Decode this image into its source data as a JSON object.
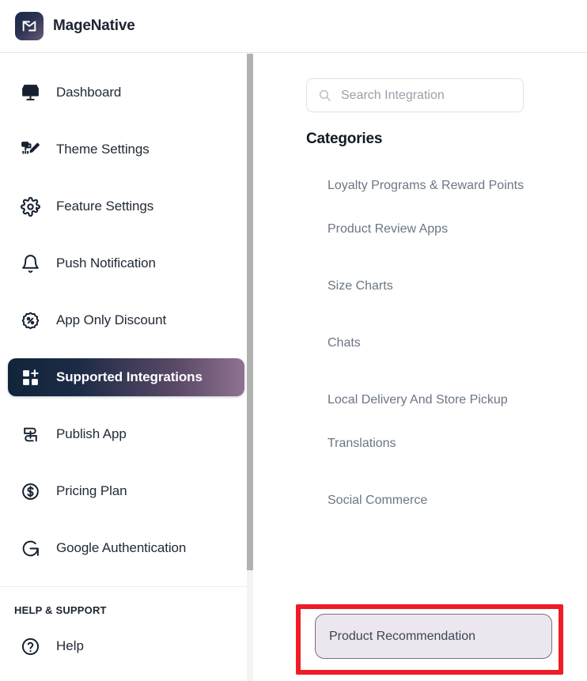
{
  "header": {
    "brand_name": "MageNative",
    "logo_icon": "magenative-monogram-icon"
  },
  "sidebar": {
    "items": [
      {
        "label": "Dashboard",
        "icon": "storefront-icon",
        "active": false
      },
      {
        "label": "Theme Settings",
        "icon": "paint-roller-pencil-icon",
        "active": false
      },
      {
        "label": "Feature Settings",
        "icon": "gear-icon",
        "active": false
      },
      {
        "label": "Push Notification",
        "icon": "bell-icon",
        "active": false
      },
      {
        "label": "App Only Discount",
        "icon": "discount-badge-icon",
        "active": false
      },
      {
        "label": "Supported Integrations",
        "icon": "grid-plus-icon",
        "active": true
      },
      {
        "label": "Publish App",
        "icon": "publish-app-icon",
        "active": false
      },
      {
        "label": "Pricing Plan",
        "icon": "dollar-circle-icon",
        "active": false
      },
      {
        "label": "Google Authentication",
        "icon": "google-g-icon",
        "active": false
      }
    ],
    "help_section": {
      "title": "HELP & SUPPORT",
      "items": [
        {
          "label": "Help",
          "icon": "question-circle-icon"
        }
      ]
    },
    "active_gradient_from": "#10253a",
    "active_gradient_to": "#8f7291"
  },
  "main": {
    "search": {
      "placeholder": "Search Integration",
      "value": "",
      "icon": "search-icon"
    },
    "categories_heading": "Categories",
    "categories": [
      {
        "label": "Loyalty Programs & Reward Points",
        "selected": false
      },
      {
        "label": "Product Review Apps",
        "selected": false
      },
      {
        "label": "Size Charts",
        "selected": false
      },
      {
        "label": "Chats",
        "selected": false
      },
      {
        "label": "Local Delivery And Store Pickup",
        "selected": false
      },
      {
        "label": "Translations",
        "selected": false
      },
      {
        "label": "Social Commerce",
        "selected": false
      },
      {
        "label": "Product Recommendation",
        "selected": true
      }
    ],
    "selected_category": "Product Recommendation",
    "selected_pill_bg": "#ece7ef",
    "selected_pill_border": "#7d6a85"
  },
  "annotation": {
    "color": "#ee1c25",
    "target": "Product Recommendation"
  }
}
